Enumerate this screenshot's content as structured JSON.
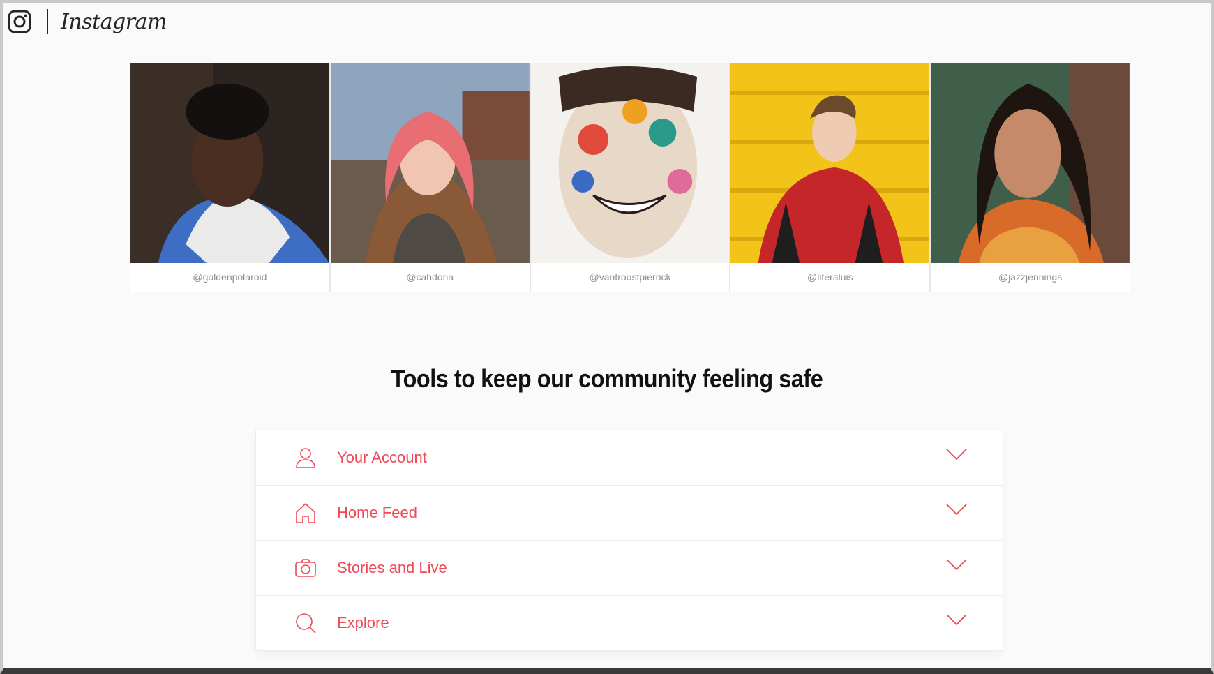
{
  "brand": {
    "wordmark": "Instagram"
  },
  "photos": [
    {
      "handle": "@goldenpolaroid",
      "palette": [
        "#2b2420",
        "#3e6ec4",
        "#f2f2f2"
      ]
    },
    {
      "handle": "@cahdoria",
      "palette": [
        "#7a8fa8",
        "#e86e74",
        "#5a4a3f"
      ]
    },
    {
      "handle": "@vantroostpierrick",
      "palette": [
        "#f4f2ee",
        "#e04a3a",
        "#2a9a8c"
      ]
    },
    {
      "handle": "@literaluis",
      "palette": [
        "#f2c318",
        "#c4262a",
        "#1e1e1e"
      ]
    },
    {
      "handle": "@jazzjennings",
      "palette": [
        "#3f5f4a",
        "#c48a6a",
        "#d86a2a"
      ]
    }
  ],
  "section": {
    "title": "Tools to keep our community feeling safe"
  },
  "accordion": [
    {
      "label": "Your Account",
      "icon": "user-icon"
    },
    {
      "label": "Home Feed",
      "icon": "home-icon"
    },
    {
      "label": "Stories and Live",
      "icon": "camera-icon"
    },
    {
      "label": "Explore",
      "icon": "search-icon"
    }
  ],
  "colors": {
    "accent": "#ed4956",
    "text": "#111111",
    "muted": "#8e8e8e"
  }
}
